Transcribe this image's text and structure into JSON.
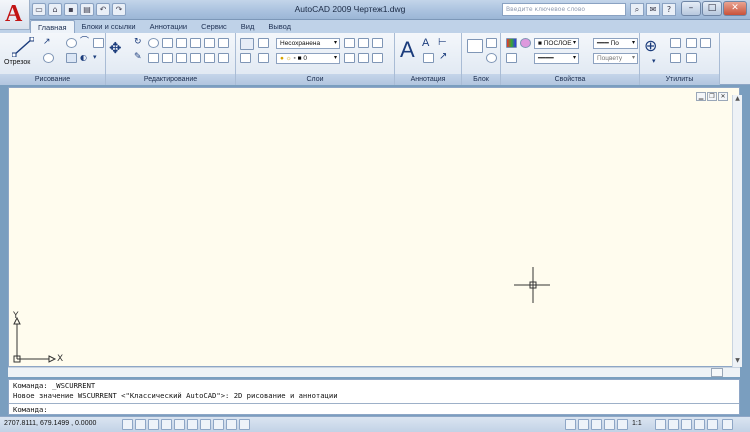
{
  "titlebar": {
    "app_logo_letter": "A",
    "title": "AutoCAD 2009 Чертеж1.dwg",
    "search_placeholder": "Введите ключевое слово",
    "window_controls": [
      "–",
      "□",
      "✕"
    ]
  },
  "ribbon_tabs": [
    "Главная",
    "Блоки и ссылки",
    "Аннотации",
    "Сервис",
    "Вид",
    "Вывод"
  ],
  "ribbon": {
    "panels": [
      "Рисование",
      "Редактирование",
      "Слои",
      "Аннотация",
      "Блок",
      "Свойства",
      "Утилиты"
    ],
    "draw": {
      "line_label": "Отрезок"
    },
    "layers": {
      "layer_state": "Несохранена",
      "current_layer": "0"
    },
    "properties": {
      "color": "ПОСЛОЕ",
      "lineweight": "По",
      "linetype": "Поцвету"
    }
  },
  "ucs": {
    "x_label": "X",
    "y_label": "Y"
  },
  "command_line": {
    "history": [
      "Команда: _WSCURRENT",
      "Новое значение WSCURRENT <\"Классический AutoCAD\">: 2D рисование и аннотации"
    ],
    "prompt": "Команда:"
  },
  "status_bar": {
    "coordinates": "2707.8111, 679.1499 , 0.0000",
    "annotation_scale": "1:1"
  },
  "colors": {
    "canvas_bg": "#fffcee",
    "frame_bg": "#7a9ebf",
    "logo_red": "#c21414"
  }
}
